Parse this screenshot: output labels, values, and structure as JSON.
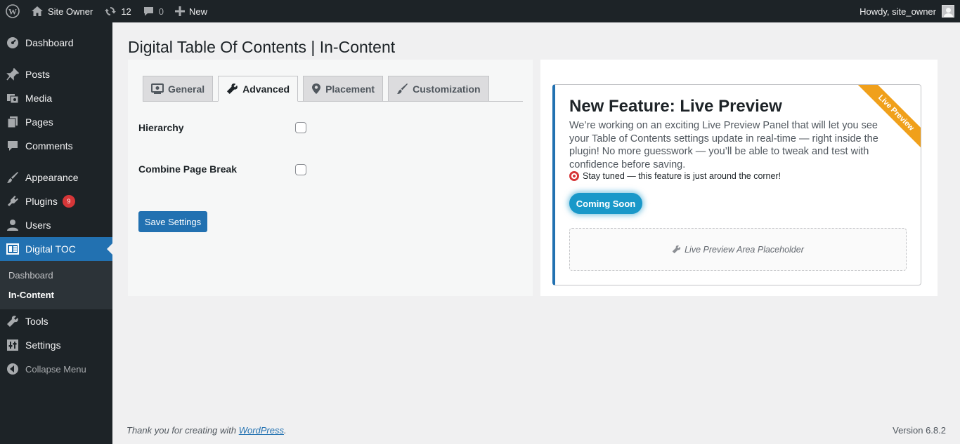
{
  "admin_bar": {
    "site_name": "Site Owner",
    "updates_count": "12",
    "comments_count": "0",
    "new_label": "New",
    "howdy": "Howdy, site_owner"
  },
  "sidebar": {
    "items": [
      {
        "label": "Dashboard",
        "icon": "dashboard-icon"
      },
      {
        "label": "Posts",
        "icon": "pin-icon"
      },
      {
        "label": "Media",
        "icon": "media-icon"
      },
      {
        "label": "Pages",
        "icon": "pages-icon"
      },
      {
        "label": "Comments",
        "icon": "comment-icon"
      },
      {
        "label": "Appearance",
        "icon": "brush-icon"
      },
      {
        "label": "Plugins",
        "icon": "plugin-icon",
        "badge": "9"
      },
      {
        "label": "Users",
        "icon": "users-icon"
      },
      {
        "label": "Digital TOC",
        "icon": "toc-icon"
      },
      {
        "label": "Tools",
        "icon": "wrench-icon"
      },
      {
        "label": "Settings",
        "icon": "settings-icon"
      }
    ],
    "submenu": [
      "Dashboard",
      "In-Content"
    ],
    "collapse_label": "Collapse Menu"
  },
  "page": {
    "title": "Digital Table Of Contents | In-Content"
  },
  "tabs": [
    {
      "label": "General",
      "icon": "monitor-icon",
      "active": false
    },
    {
      "label": "Advanced",
      "icon": "wrench-icon",
      "active": true
    },
    {
      "label": "Placement",
      "icon": "location-icon",
      "active": false
    },
    {
      "label": "Customization",
      "icon": "brush-icon",
      "active": false
    }
  ],
  "fields": [
    {
      "label": "Hierarchy",
      "checked": false
    },
    {
      "label": "Combine Page Break",
      "checked": false
    }
  ],
  "save_button": "Save Settings",
  "preview": {
    "ribbon": "Live Preview",
    "title": "New Feature: Live Preview",
    "description": "We’re working on an exciting Live Preview Panel that will let you see your Table of Contents settings update in real-time — right inside the plugin! No more guesswork — you’ll be able to tweak and test with confidence before saving.",
    "note": "Stay tuned — this feature is just around the corner!",
    "button": "Coming Soon",
    "placeholder": "Live Preview Area Placeholder"
  },
  "footer": {
    "thanks_prefix": "Thank you for creating with ",
    "thanks_link": "WordPress",
    "thanks_suffix": ".",
    "version": "Version 6.8.2"
  },
  "colors": {
    "admin_bg": "#1d2327",
    "accent": "#2271b1",
    "ribbon": "#f0a01b",
    "badge": "#d63638",
    "coming_soon": "#1998c9"
  }
}
